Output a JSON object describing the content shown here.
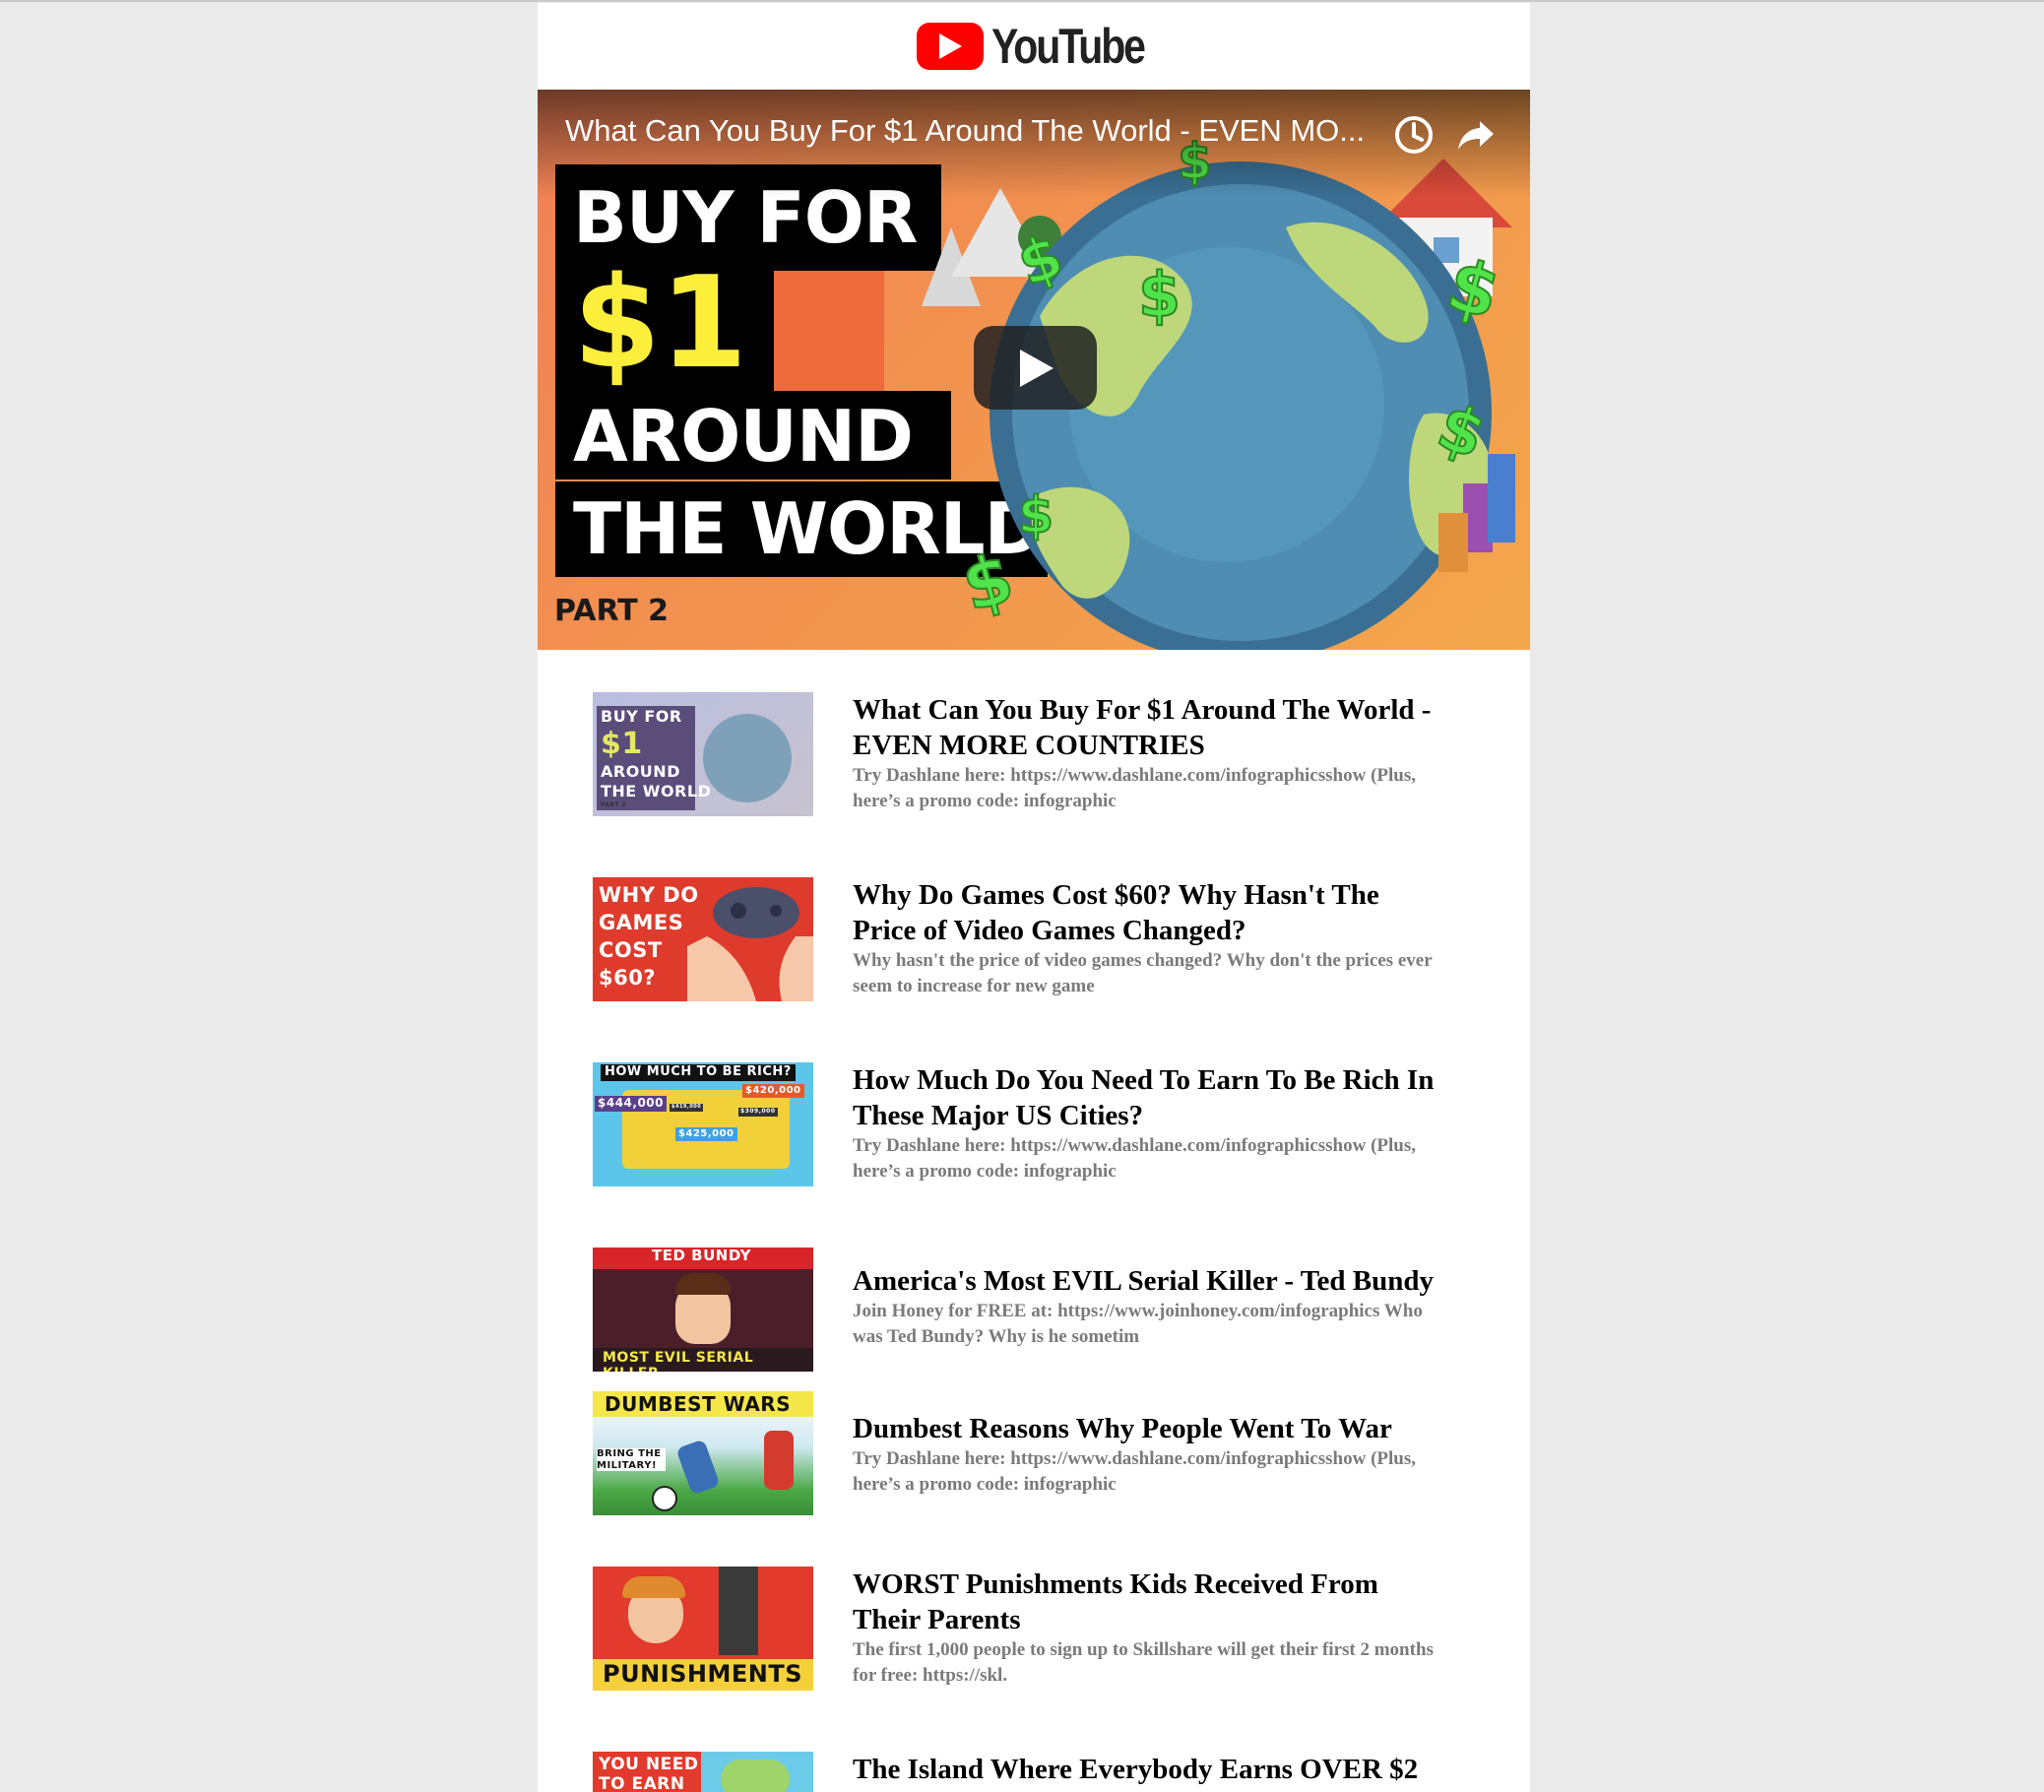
{
  "app": {
    "logo_text": "YouTube",
    "brand_color": "#ff0000"
  },
  "hero": {
    "title": "What Can You Buy For $1 Around The World - EVEN MO...",
    "watch_later_icon": "clock-icon",
    "share_icon": "share-icon",
    "play_icon": "play-icon",
    "thumb_text": {
      "line1": "BUY FOR",
      "line2": "$1",
      "line3": "AROUND",
      "line4": "THE WORLD",
      "line5": "PART 2"
    }
  },
  "videos": [
    {
      "title": "What Can You Buy For $1 Around The World - EVEN MORE COUNTRIES",
      "description": "Try Dashlane here: https://www.dashlane.com/infographicsshow (Plus, here’s a promo code: infographic",
      "thumb_text": [
        "BUY FOR",
        "$1",
        "AROUND",
        "THE WORLD",
        "PART 2"
      ]
    },
    {
      "title": "Why Do Games Cost $60? Why Hasn't The Price of Video Games Changed?",
      "description": "Why hasn't the price of video games changed? Why don't the prices ever seem to increase for new game",
      "thumb_text": [
        "WHY DO",
        "GAMES",
        "COST",
        "$60?"
      ]
    },
    {
      "title": "How Much Do You Need To Earn To Be Rich In These Major US Cities?",
      "description": "Try Dashlane here: https://www.dashlane.com/infographicsshow (Plus, here’s a promo code: infographic",
      "thumb_text": [
        "HOW MUCH TO BE RICH?",
        "$444,000",
        "$420,000",
        "$425,000",
        "$419,000",
        "$309,000"
      ]
    },
    {
      "title": "America's Most EVIL Serial Killer - Ted Bundy",
      "description": "Join Honey for FREE at: https://www.joinhoney.com/infographics Who was Ted Bundy? Why is he sometim",
      "thumb_text": [
        "TED BUNDY",
        "MOST EVIL SERIAL KILLER"
      ]
    },
    {
      "title": "Dumbest Reasons Why People Went To War",
      "description": "Try Dashlane here: https://www.dashlane.com/infographicsshow (Plus, here’s a promo code: infographic",
      "thumb_text": [
        "DUMBEST WARS",
        "BRING THE MILITARY!"
      ]
    },
    {
      "title": "WORST Punishments Kids Received From Their Parents",
      "description": "The first 1,000 people to sign up to Skillshare will get their first 2 months for free: https://skl.",
      "thumb_text": [
        "PUNISHMENTS"
      ]
    },
    {
      "title": "The Island Where Everybody Earns OVER $2",
      "description": "",
      "thumb_text": [
        "YOU NEED",
        "TO EARN"
      ]
    }
  ]
}
